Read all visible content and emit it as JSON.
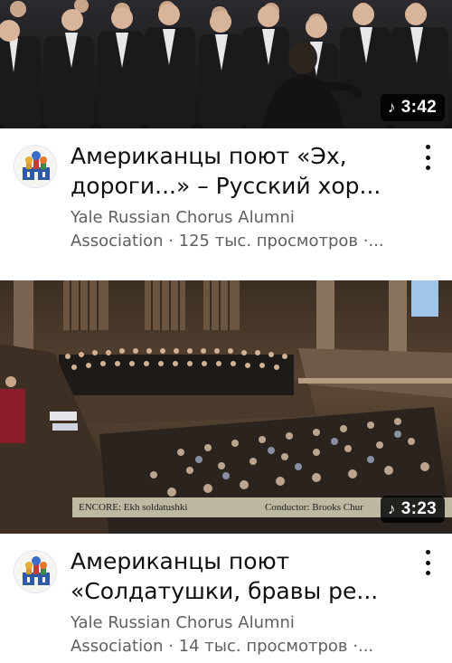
{
  "feed": {
    "videos": [
      {
        "duration": "3:42",
        "title_line1": "Американцы поют «Эх,",
        "title_line2": "дороги...» – Русский хор...",
        "channel": "Yale Russian Chorus Alumni",
        "stats": "Association · 125 тыс. просмотров ·..."
      },
      {
        "duration": "3:23",
        "caption_encore": "ENCORE: Ekh soldatushki",
        "caption_conductor": "Conductor: Brooks Chur",
        "title_line1": "Американцы поют",
        "title_line2": "«Солдатушки, бравы ре...",
        "channel": "Yale Russian Chorus Alumni",
        "stats": "Association · 14 тыс. просмотров ·..."
      }
    ]
  },
  "icons": {
    "duration_prefix": "music-note-icon",
    "menu": "more-vertical-icon",
    "avatar": "channel-logo-icon"
  },
  "colors": {
    "title": "#0f0f0f",
    "secondary": "#606060",
    "duration_bg": "#000000"
  }
}
